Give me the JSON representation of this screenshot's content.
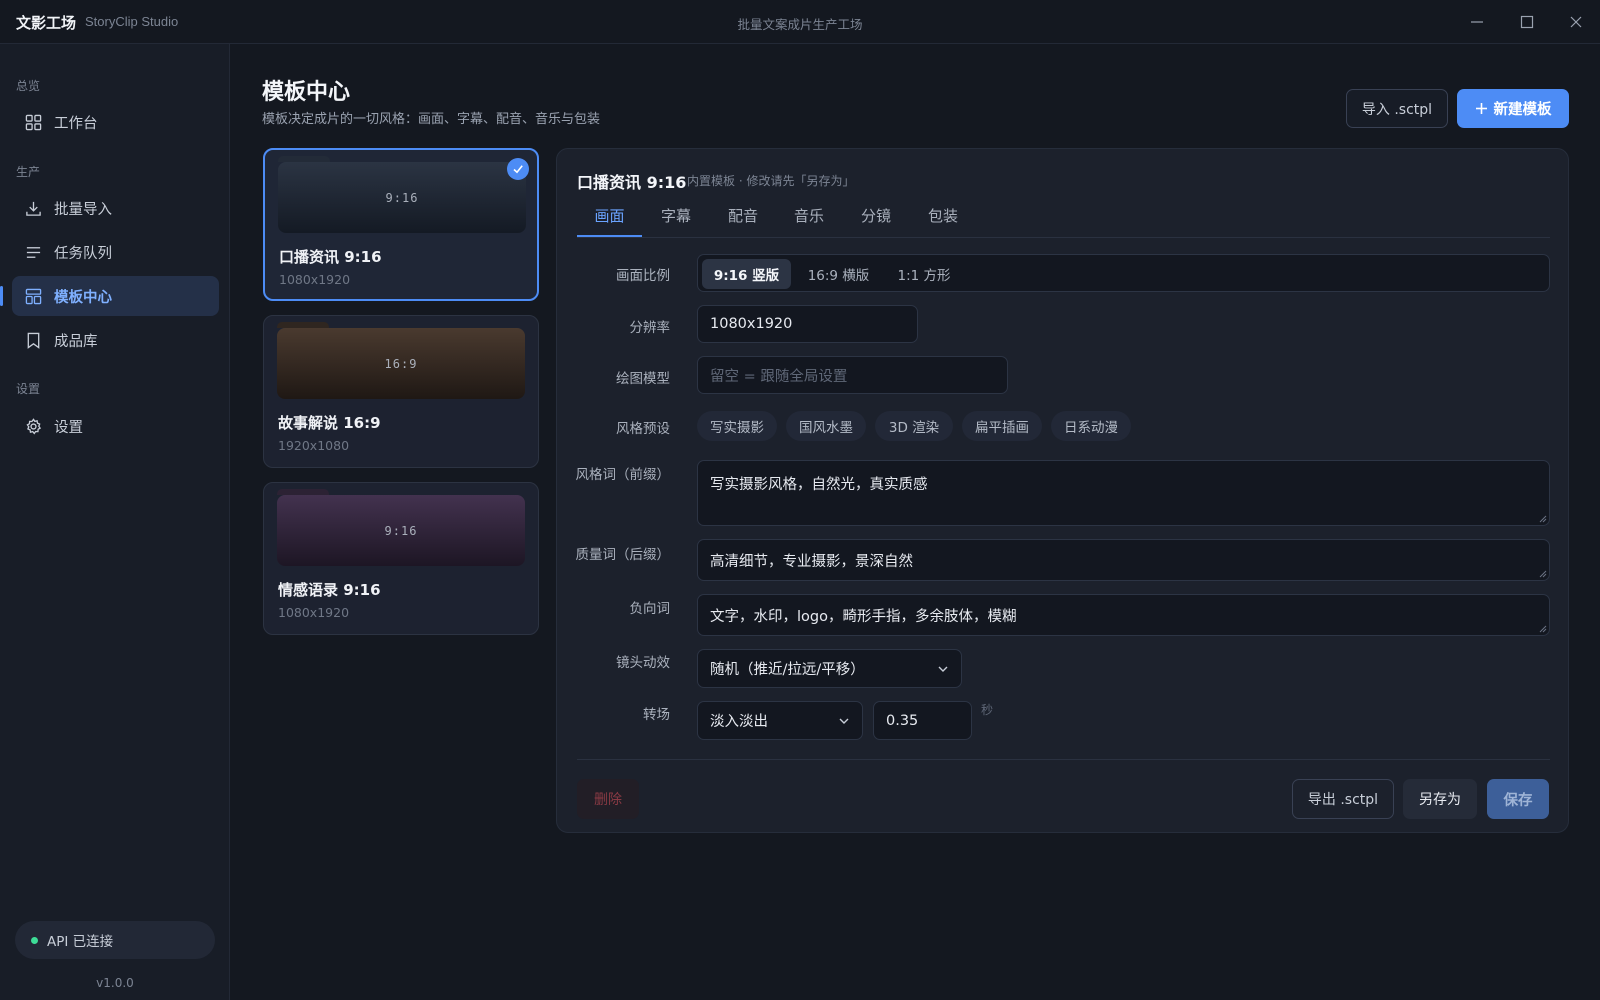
{
  "titlebar": {
    "app_name": "文影工场",
    "app_sub": "StoryClip Studio",
    "window_title": "批量文案成片生产工场"
  },
  "sidebar": {
    "sections": [
      {
        "label": "总览"
      },
      {
        "label": "生产"
      },
      {
        "label": "设置"
      }
    ],
    "items": [
      {
        "label": "工作台",
        "icon": "dashboard-icon"
      },
      {
        "label": "批量导入",
        "icon": "download-icon"
      },
      {
        "label": "任务队列",
        "icon": "list-icon"
      },
      {
        "label": "模板中心",
        "icon": "template-icon",
        "active": true
      },
      {
        "label": "成品库",
        "icon": "bookmark-icon"
      },
      {
        "label": "设置",
        "icon": "gear-icon"
      }
    ],
    "api_status": "API 已连接",
    "version": "v1.0.0"
  },
  "header": {
    "title": "模板中心",
    "description": "模板决定成片的一切风格：画面、字幕、配音、音乐与包装",
    "import_label": "导入 .sctpl",
    "new_label": "新建模板",
    "new_icon": "plus-icon"
  },
  "templates": [
    {
      "ratio": "9:16",
      "name": "口播资讯 9:16",
      "resolution": "1080x1920",
      "selected": true
    },
    {
      "ratio": "16:9",
      "name": "故事解说 16:9",
      "resolution": "1920x1080"
    },
    {
      "ratio": "9:16",
      "name": "情感语录 9:16",
      "resolution": "1080x1920"
    }
  ],
  "editor": {
    "title": "口播资讯 9:16",
    "note": "内置模板 · 修改请先「另存为」",
    "tabs": [
      "画面",
      "字幕",
      "配音",
      "音乐",
      "分镜",
      "包装"
    ],
    "active_tab": "画面",
    "fields": {
      "aspect": {
        "label": "画面比例",
        "options": [
          "9:16 竖版",
          "16:9 横版",
          "1:1 方形"
        ],
        "selected": "9:16 竖版"
      },
      "resolution": {
        "label": "分辨率",
        "value": "1080x1920"
      },
      "model": {
        "label": "绘图模型",
        "placeholder": "留空 = 跟随全局设置"
      },
      "style_preset": {
        "label": "风格预设",
        "chips": [
          "写实摄影",
          "国风水墨",
          "3D 渲染",
          "扁平插画",
          "日系动漫"
        ]
      },
      "prefix": {
        "label": "风格词（前缀）",
        "value": "写实摄影风格，自然光，真实质感"
      },
      "suffix": {
        "label": "质量词（后缀）",
        "value": "高清细节，专业摄影，景深自然"
      },
      "negative": {
        "label": "负向词",
        "value": "文字，水印，logo，畸形手指，多余肢体，模糊"
      },
      "camera": {
        "label": "镜头动效",
        "value": "随机（推近/拉远/平移）"
      },
      "transition": {
        "label": "转场",
        "value": "淡入淡出",
        "duration": "0.35",
        "unit": "秒"
      }
    },
    "footer": {
      "delete_label": "删除",
      "export_label": "导出 .sctpl",
      "saveas_label": "另存为",
      "save_label": "保存"
    }
  },
  "colors": {
    "accent": "#4d8cf5",
    "background": "#141820",
    "sidebar": "#181d27",
    "panel": "#1c212c",
    "status_ok": "#3ddc97",
    "danger_text": "#8a3a44"
  }
}
